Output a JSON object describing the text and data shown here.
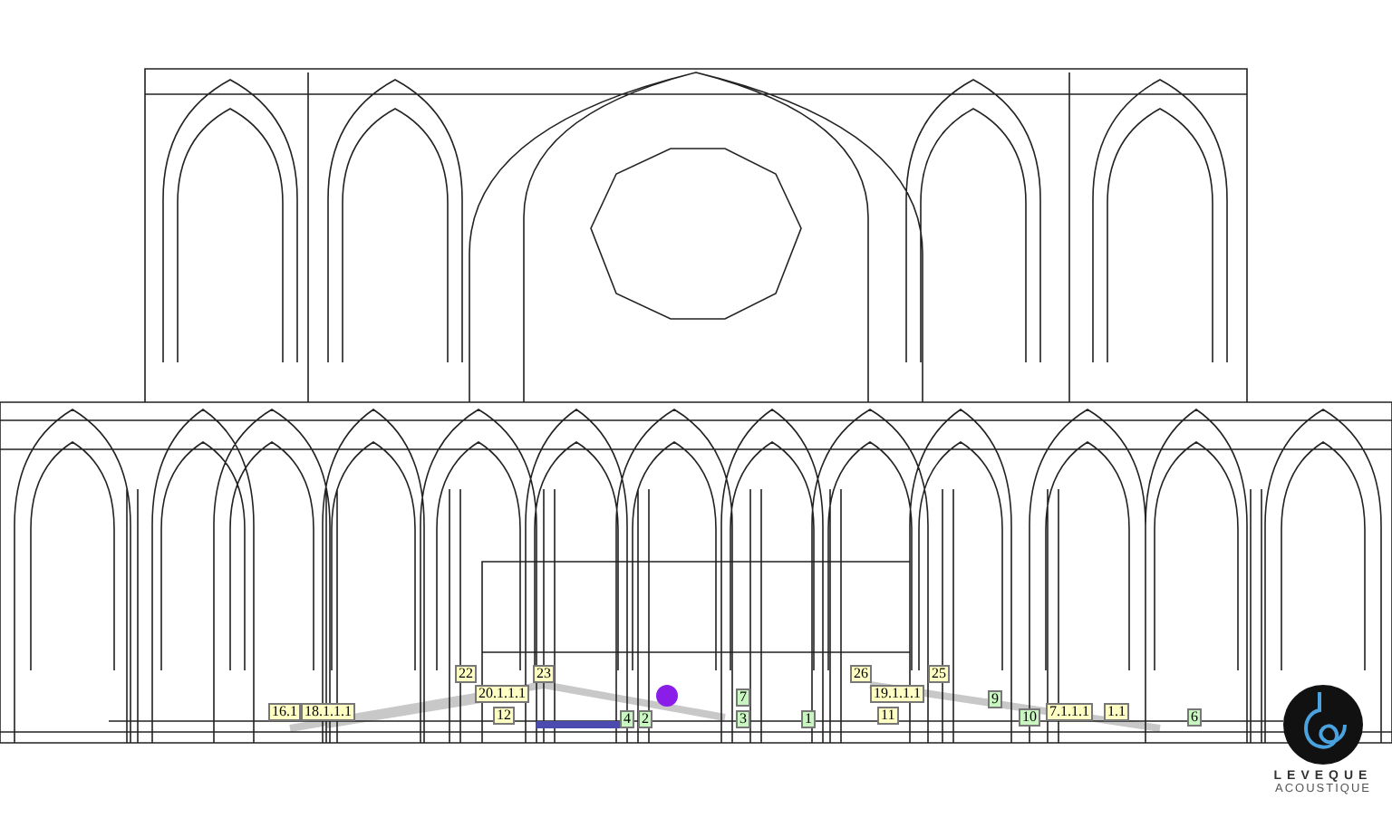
{
  "viewport": {
    "markers": [
      {
        "label": "16.1",
        "kind": "receiver"
      },
      {
        "label": "18.1.1.1",
        "kind": "receiver"
      },
      {
        "label": "22",
        "kind": "receiver"
      },
      {
        "label": "20.1.1.1",
        "kind": "receiver"
      },
      {
        "label": "23",
        "kind": "receiver"
      },
      {
        "label": "12",
        "kind": "receiver"
      },
      {
        "label": "26",
        "kind": "receiver"
      },
      {
        "label": "19.1.1.1",
        "kind": "receiver"
      },
      {
        "label": "25",
        "kind": "receiver"
      },
      {
        "label": "11",
        "kind": "receiver"
      },
      {
        "label": "7.1.1.1",
        "kind": "receiver"
      },
      {
        "label": "1.1",
        "kind": "receiver"
      },
      {
        "label": "4",
        "kind": "source"
      },
      {
        "label": "2",
        "kind": "source"
      },
      {
        "label": "7",
        "kind": "source"
      },
      {
        "label": "3",
        "kind": "source"
      },
      {
        "label": "1",
        "kind": "source"
      },
      {
        "label": "9",
        "kind": "source"
      },
      {
        "label": "10",
        "kind": "source"
      },
      {
        "label": "6",
        "kind": "source"
      }
    ]
  },
  "logo": {
    "name": "LEVEQUE",
    "subtitle": "ACOUSTIQUE"
  }
}
